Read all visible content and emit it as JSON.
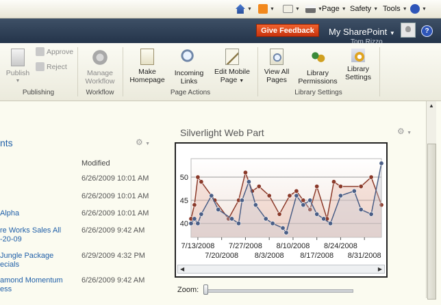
{
  "ie_toolbar": {
    "page_label": "Page",
    "safety_label": "Safety",
    "tools_label": "Tools"
  },
  "topbar": {
    "feedback_label": "Give Feedback",
    "my_sharepoint_label": "My SharePoint",
    "user_name": "Tom Rizzo"
  },
  "ribbon": {
    "publishing": {
      "publish": "Publish",
      "approve": "Approve",
      "reject": "Reject",
      "group": "Publishing"
    },
    "workflow": {
      "manage_line1": "Manage",
      "manage_line2": "Workflow",
      "group": "Workflow"
    },
    "page_actions": {
      "make_line1": "Make",
      "make_line2": "Homepage",
      "incoming_line1": "Incoming",
      "incoming_line2": "Links",
      "edit_line1": "Edit Mobile",
      "edit_line2": "Page",
      "group": "Page Actions"
    },
    "library_settings": {
      "view_line1": "View All",
      "view_line2": "Pages",
      "perm_line1": "Library",
      "perm_line2": "Permissions",
      "settings_line1": "Library",
      "settings_line2": "Settings",
      "group": "Library Settings"
    }
  },
  "left_part": {
    "title": "nts",
    "modified_header": "Modified",
    "items": [
      {
        "title_lines": [
          "",
          ""
        ],
        "date": "6/26/2009 10:01 AM"
      },
      {
        "title_lines": [
          "",
          ""
        ],
        "date": "6/26/2009 10:01 AM"
      },
      {
        "title_lines": [
          "Alpha",
          ""
        ],
        "date": "6/26/2009 10:01 AM"
      },
      {
        "title_lines": [
          "re Works Sales All",
          "-20-09"
        ],
        "date": "6/26/2009 9:42 AM"
      },
      {
        "title_lines": [
          "Jungle Package",
          "ecials"
        ],
        "date": "6/29/2009 4:32 PM"
      },
      {
        "title_lines": [
          "amond Momentum",
          "ess"
        ],
        "date": "6/26/2009 9:42 AM"
      }
    ]
  },
  "silverlight": {
    "title": "Silverlight Web Part",
    "zoom_label": "Zoom:",
    "zoom_value": 0
  },
  "chart_data": {
    "type": "line",
    "title": "",
    "xlabel": "",
    "ylabel": "",
    "ylim": [
      37,
      54
    ],
    "y_ticks": [
      40,
      45,
      50
    ],
    "x_ticks_top": [
      "7/13/2008",
      "7/27/2008",
      "8/10/2008",
      "8/24/2008"
    ],
    "x_ticks_bottom": [
      "7/20/2008",
      "8/3/2008",
      "8/17/2008",
      "8/31/2008"
    ],
    "x_tick_dates": [
      "7/13/2008",
      "7/20/2008",
      "7/27/2008",
      "8/3/2008",
      "8/10/2008",
      "8/17/2008",
      "8/24/2008",
      "8/31/2008"
    ],
    "x_range": [
      "7/11/2008",
      "9/5/2008"
    ],
    "grid": true,
    "colors": {
      "red": "#8b3a2a",
      "blue": "#4a5e86",
      "red_fill": "#e8b8a8",
      "blue_fill": "#c8ccd8"
    },
    "series": [
      {
        "color": "red",
        "x": [
          "7/11/2008",
          "7/12/2008",
          "7/13/2008",
          "7/14/2008",
          "7/18/2008",
          "7/22/2008",
          "7/25/2008",
          "7/27/2008",
          "7/29/2008",
          "7/31/2008",
          "8/3/2008",
          "8/6/2008",
          "8/9/2008",
          "8/11/2008",
          "8/13/2008",
          "8/15/2008",
          "8/17/2008",
          "8/20/2008",
          "8/22/2008",
          "8/24/2008",
          "8/30/2008",
          "9/2/2008",
          "9/5/2008"
        ],
        "y": [
          41,
          44,
          50,
          49,
          45,
          41,
          45,
          51,
          47,
          48,
          46,
          42,
          46,
          47,
          45,
          43,
          48,
          41,
          49,
          48,
          48,
          50,
          44
        ]
      },
      {
        "color": "blue",
        "x": [
          "7/11/2008",
          "7/12/2008",
          "7/13/2008",
          "7/14/2008",
          "7/17/2008",
          "7/19/2008",
          "7/23/2008",
          "7/25/2008",
          "7/26/2008",
          "7/28/2008",
          "7/30/2008",
          "8/2/2008",
          "8/4/2008",
          "8/7/2008",
          "8/8/2008",
          "8/11/2008",
          "8/13/2008",
          "8/15/2008",
          "8/17/2008",
          "8/19/2008",
          "8/21/2008",
          "8/24/2008",
          "8/28/2008",
          "8/30/2008",
          "9/2/2008",
          "9/5/2008"
        ],
        "y": [
          40,
          41,
          40,
          42,
          46,
          43,
          41,
          40,
          45,
          49,
          44,
          41,
          40,
          39,
          38,
          46,
          44,
          45,
          42,
          41,
          40,
          46,
          47,
          43,
          42,
          53
        ]
      }
    ]
  }
}
